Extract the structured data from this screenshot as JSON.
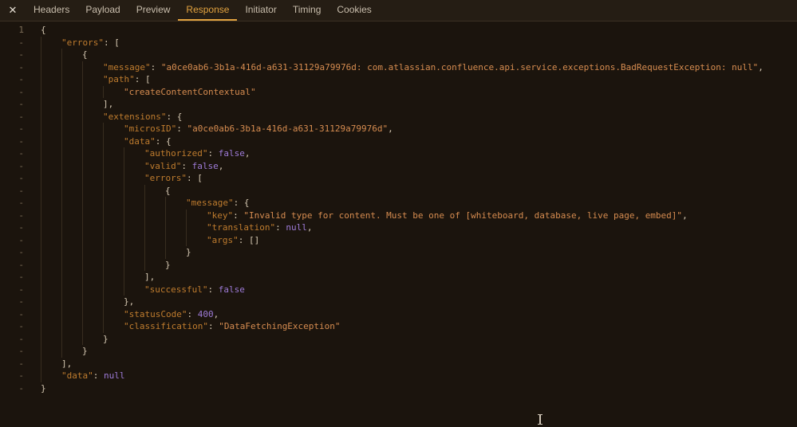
{
  "colors": {
    "bg": "#1b140d",
    "topbar-bg": "#251d14",
    "topbar-border": "#3a3023",
    "tab-text": "#c9bead",
    "tab-active": "#e2a23f",
    "close": "#e4ddd2",
    "gutter-text": "#7d6e58",
    "guide": "#382d1f",
    "punct": "#d5c8b2",
    "key": "#bf7c2e",
    "string": "#d68c50",
    "keyword": "#9e7bd8",
    "number": "#9e7bd8",
    "cursor": "#cfc5b6"
  },
  "tabs": {
    "close_icon": "✕",
    "items": [
      "Headers",
      "Payload",
      "Preview",
      "Response",
      "Initiator",
      "Timing",
      "Cookies"
    ],
    "active": "Response"
  },
  "editor": {
    "lines": [
      {
        "g": "1",
        "i": 0,
        "t": [
          {
            "c": "p",
            "v": "{"
          }
        ]
      },
      {
        "g": "-",
        "i": 1,
        "t": [
          {
            "c": "k",
            "v": "\"errors\""
          },
          {
            "c": "p",
            "v": ": ["
          }
        ]
      },
      {
        "g": "-",
        "i": 2,
        "t": [
          {
            "c": "p",
            "v": "{"
          }
        ]
      },
      {
        "g": "-",
        "i": 3,
        "t": [
          {
            "c": "k",
            "v": "\"message\""
          },
          {
            "c": "p",
            "v": ": "
          },
          {
            "c": "s",
            "v": "\"a0ce0ab6-3b1a-416d-a631-31129a79976d: com.atlassian.confluence.api.service.exceptions.BadRequestException: null\""
          },
          {
            "c": "p",
            "v": ","
          }
        ]
      },
      {
        "g": "-",
        "i": 3,
        "t": [
          {
            "c": "k",
            "v": "\"path\""
          },
          {
            "c": "p",
            "v": ": ["
          }
        ]
      },
      {
        "g": "-",
        "i": 4,
        "t": [
          {
            "c": "s",
            "v": "\"createContentContextual\""
          }
        ]
      },
      {
        "g": "-",
        "i": 3,
        "t": [
          {
            "c": "p",
            "v": "],"
          }
        ]
      },
      {
        "g": "-",
        "i": 3,
        "t": [
          {
            "c": "k",
            "v": "\"extensions\""
          },
          {
            "c": "p",
            "v": ": {"
          }
        ]
      },
      {
        "g": "-",
        "i": 4,
        "t": [
          {
            "c": "k",
            "v": "\"microsID\""
          },
          {
            "c": "p",
            "v": ": "
          },
          {
            "c": "s",
            "v": "\"a0ce0ab6-3b1a-416d-a631-31129a79976d\""
          },
          {
            "c": "p",
            "v": ","
          }
        ]
      },
      {
        "g": "-",
        "i": 4,
        "t": [
          {
            "c": "k",
            "v": "\"data\""
          },
          {
            "c": "p",
            "v": ": {"
          }
        ]
      },
      {
        "g": "-",
        "i": 5,
        "t": [
          {
            "c": "k",
            "v": "\"authorized\""
          },
          {
            "c": "p",
            "v": ": "
          },
          {
            "c": "w",
            "v": "false"
          },
          {
            "c": "p",
            "v": ","
          }
        ]
      },
      {
        "g": "-",
        "i": 5,
        "t": [
          {
            "c": "k",
            "v": "\"valid\""
          },
          {
            "c": "p",
            "v": ": "
          },
          {
            "c": "w",
            "v": "false"
          },
          {
            "c": "p",
            "v": ","
          }
        ]
      },
      {
        "g": "-",
        "i": 5,
        "t": [
          {
            "c": "k",
            "v": "\"errors\""
          },
          {
            "c": "p",
            "v": ": ["
          }
        ]
      },
      {
        "g": "-",
        "i": 6,
        "t": [
          {
            "c": "p",
            "v": "{"
          }
        ]
      },
      {
        "g": "-",
        "i": 7,
        "t": [
          {
            "c": "k",
            "v": "\"message\""
          },
          {
            "c": "p",
            "v": ": {"
          }
        ]
      },
      {
        "g": "-",
        "i": 8,
        "t": [
          {
            "c": "k",
            "v": "\"key\""
          },
          {
            "c": "p",
            "v": ": "
          },
          {
            "c": "s",
            "v": "\"Invalid type for content. Must be one of [whiteboard, database, live page, embed]\""
          },
          {
            "c": "p",
            "v": ","
          }
        ]
      },
      {
        "g": "-",
        "i": 8,
        "t": [
          {
            "c": "k",
            "v": "\"translation\""
          },
          {
            "c": "p",
            "v": ": "
          },
          {
            "c": "w",
            "v": "null"
          },
          {
            "c": "p",
            "v": ","
          }
        ]
      },
      {
        "g": "-",
        "i": 8,
        "t": [
          {
            "c": "k",
            "v": "\"args\""
          },
          {
            "c": "p",
            "v": ": []"
          }
        ]
      },
      {
        "g": "-",
        "i": 7,
        "t": [
          {
            "c": "p",
            "v": "}"
          }
        ]
      },
      {
        "g": "-",
        "i": 6,
        "t": [
          {
            "c": "p",
            "v": "}"
          }
        ]
      },
      {
        "g": "-",
        "i": 5,
        "t": [
          {
            "c": "p",
            "v": "],"
          }
        ]
      },
      {
        "g": "-",
        "i": 5,
        "t": [
          {
            "c": "k",
            "v": "\"successful\""
          },
          {
            "c": "p",
            "v": ": "
          },
          {
            "c": "w",
            "v": "false"
          }
        ]
      },
      {
        "g": "-",
        "i": 4,
        "t": [
          {
            "c": "p",
            "v": "},"
          }
        ]
      },
      {
        "g": "-",
        "i": 4,
        "t": [
          {
            "c": "k",
            "v": "\"statusCode\""
          },
          {
            "c": "p",
            "v": ": "
          },
          {
            "c": "n",
            "v": "400"
          },
          {
            "c": "p",
            "v": ","
          }
        ]
      },
      {
        "g": "-",
        "i": 4,
        "t": [
          {
            "c": "k",
            "v": "\"classification\""
          },
          {
            "c": "p",
            "v": ": "
          },
          {
            "c": "s",
            "v": "\"DataFetchingException\""
          }
        ]
      },
      {
        "g": "-",
        "i": 3,
        "t": [
          {
            "c": "p",
            "v": "}"
          }
        ]
      },
      {
        "g": "-",
        "i": 2,
        "t": [
          {
            "c": "p",
            "v": "}"
          }
        ]
      },
      {
        "g": "-",
        "i": 1,
        "t": [
          {
            "c": "p",
            "v": "],"
          }
        ]
      },
      {
        "g": "-",
        "i": 1,
        "t": [
          {
            "c": "k",
            "v": "\"data\""
          },
          {
            "c": "p",
            "v": ": "
          },
          {
            "c": "w",
            "v": "null"
          }
        ]
      },
      {
        "g": "-",
        "i": 0,
        "t": [
          {
            "c": "p",
            "v": "}"
          }
        ]
      }
    ]
  }
}
